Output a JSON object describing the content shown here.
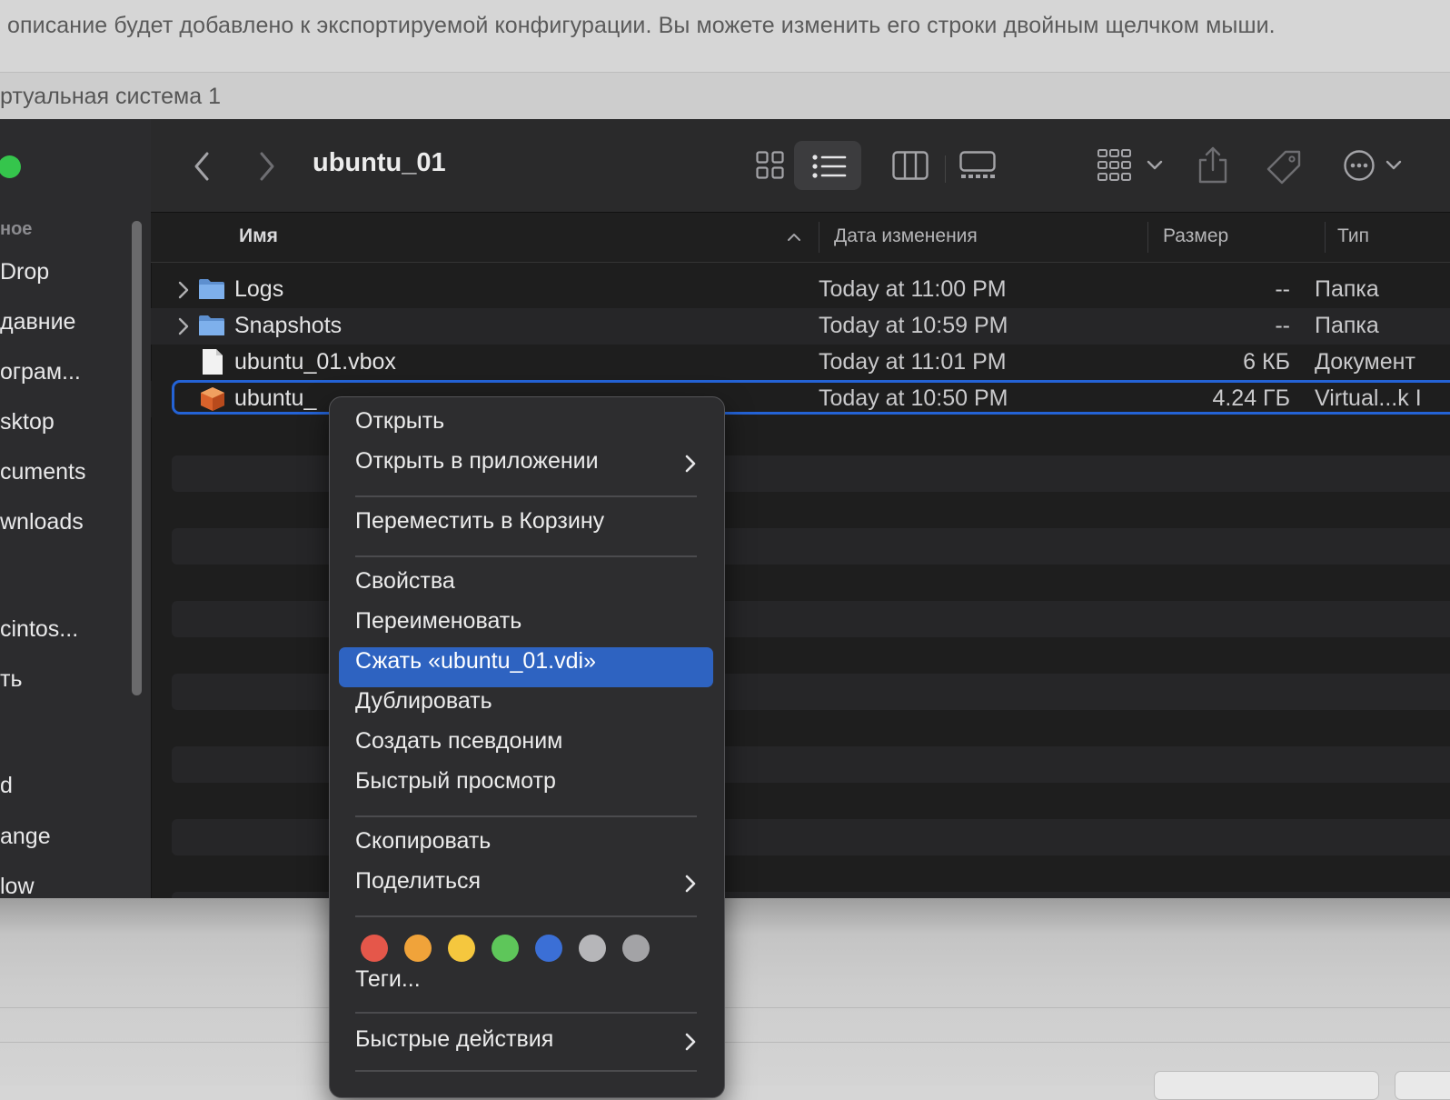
{
  "background": {
    "description": "описание будет добавлено к экспортируемой конфигурации. Вы можете изменить его строки двойным щелчком мыши.",
    "vm_label": "ртуальная система 1"
  },
  "sidebar": {
    "section_header": "ное",
    "items": [
      "Drop",
      "давние",
      "ограм...",
      "sktop",
      "cuments",
      "wnloads",
      "cintos...",
      "ть",
      "d",
      "ange",
      "low"
    ]
  },
  "toolbar": {
    "title": "ubuntu_01",
    "icons": [
      "back-icon",
      "forward-icon",
      "grid-view-icon",
      "list-view-icon",
      "column-view-icon",
      "gallery-view-icon",
      "group-icon",
      "share-icon",
      "tag-icon",
      "more-icon"
    ]
  },
  "columns": {
    "name": "Имя",
    "modified": "Дата изменения",
    "size": "Размер",
    "kind": "Тип"
  },
  "files": [
    {
      "name": "Logs",
      "date": "Today at 11:00 PM",
      "size": "--",
      "kind": "Папка",
      "icon": "folder-icon",
      "expandable": true
    },
    {
      "name": "Snapshots",
      "date": "Today at 10:59 PM",
      "size": "--",
      "kind": "Папка",
      "icon": "folder-icon",
      "expandable": true
    },
    {
      "name": "ubuntu_01.vbox",
      "date": "Today at 11:01 PM",
      "size": "6 КБ",
      "kind": "Документ",
      "icon": "document-icon",
      "expandable": false
    },
    {
      "name": "ubuntu_",
      "date": "Today at 10:50 PM",
      "size": "4.24 ГБ",
      "kind": "Virtual...k I",
      "icon": "virtualbox-disk-icon",
      "expandable": false,
      "selected": true
    }
  ],
  "context_menu": {
    "open": "Открыть",
    "open_with": "Открыть в приложении",
    "move_to_trash": "Переместить в Корзину",
    "get_info": "Свойства",
    "rename": "Переименовать",
    "compress": "Сжать «ubuntu_01.vdi»",
    "duplicate": "Дублировать",
    "make_alias": "Создать псевдоним",
    "quick_look": "Быстрый просмотр",
    "copy": "Скопировать",
    "share": "Поделиться",
    "tags": "Теги...",
    "quick_actions": "Быстрые действия",
    "tag_colors": [
      "#e5574a",
      "#f0a33a",
      "#f5c73e",
      "#5ec65a",
      "#3b6fd6",
      "#b6b6b9",
      "#a3a3a6"
    ]
  }
}
